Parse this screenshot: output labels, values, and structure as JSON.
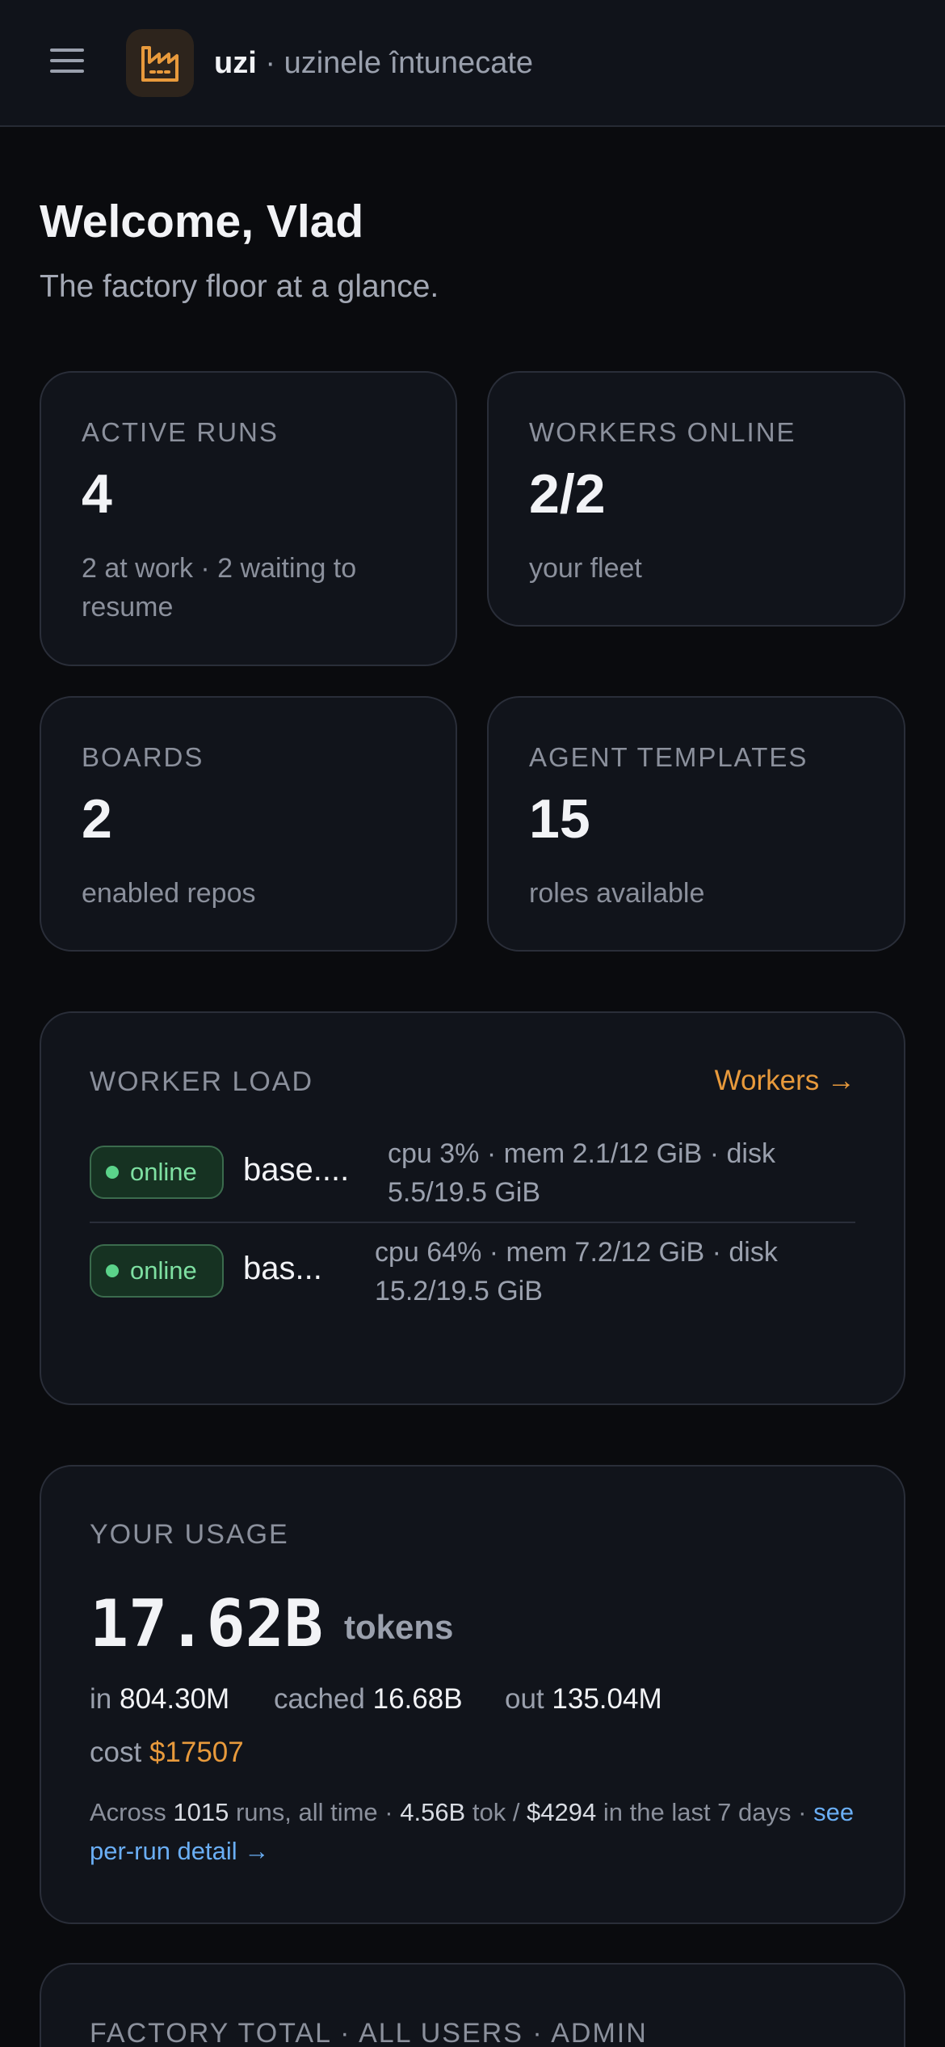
{
  "header": {
    "brand_name": "uzi",
    "brand_sep": " · ",
    "brand_subtitle": "uzinele întunecate"
  },
  "welcome": {
    "title": "Welcome, Vlad",
    "subtitle": "The factory floor at a glance."
  },
  "stats": [
    {
      "label": "ACTIVE RUNS",
      "value": "4",
      "note": "2 at work · 2 waiting to resume"
    },
    {
      "label": "WORKERS ONLINE",
      "value": "2/2",
      "note": "your fleet"
    },
    {
      "label": "BOARDS",
      "value": "2",
      "note": "enabled repos"
    },
    {
      "label": "AGENT TEMPLATES",
      "value": "15",
      "note": "roles available"
    }
  ],
  "worker_load": {
    "label": "WORKER LOAD",
    "link": "Workers →",
    "workers": [
      {
        "status": "online",
        "name": "base....",
        "stats": "cpu 3% · mem 2.1/12 GiB · disk 5.5/19.5 GiB"
      },
      {
        "status": "online",
        "name": "bas...",
        "stats": "cpu 64% · mem 7.2/12 GiB · disk 15.2/19.5 GiB"
      }
    ]
  },
  "usage": {
    "label": "YOUR USAGE",
    "total": "17.62B",
    "unit": "tokens",
    "in_label": "in",
    "in_value": "804.30M",
    "cached_label": "cached",
    "cached_value": "16.68B",
    "out_label": "out",
    "out_value": "135.04M",
    "cost_label": "cost",
    "cost_value": "$17507",
    "foot_a": "Across ",
    "foot_runs": "1015",
    "foot_b": " runs, all time · ",
    "foot_tok": "4.56B",
    "foot_c": " tok / ",
    "foot_cost": "$4294",
    "foot_d": " in the last 7 days · ",
    "foot_link": "see per-run detail →"
  },
  "factory_total": {
    "label": "FACTORY TOTAL · ALL USERS · ADMIN"
  },
  "colors": {
    "accent": "#e89a3c",
    "online": "#7ee0a2",
    "link": "#6aaef5",
    "background": "#0a0b0e",
    "card": "#11141b"
  }
}
